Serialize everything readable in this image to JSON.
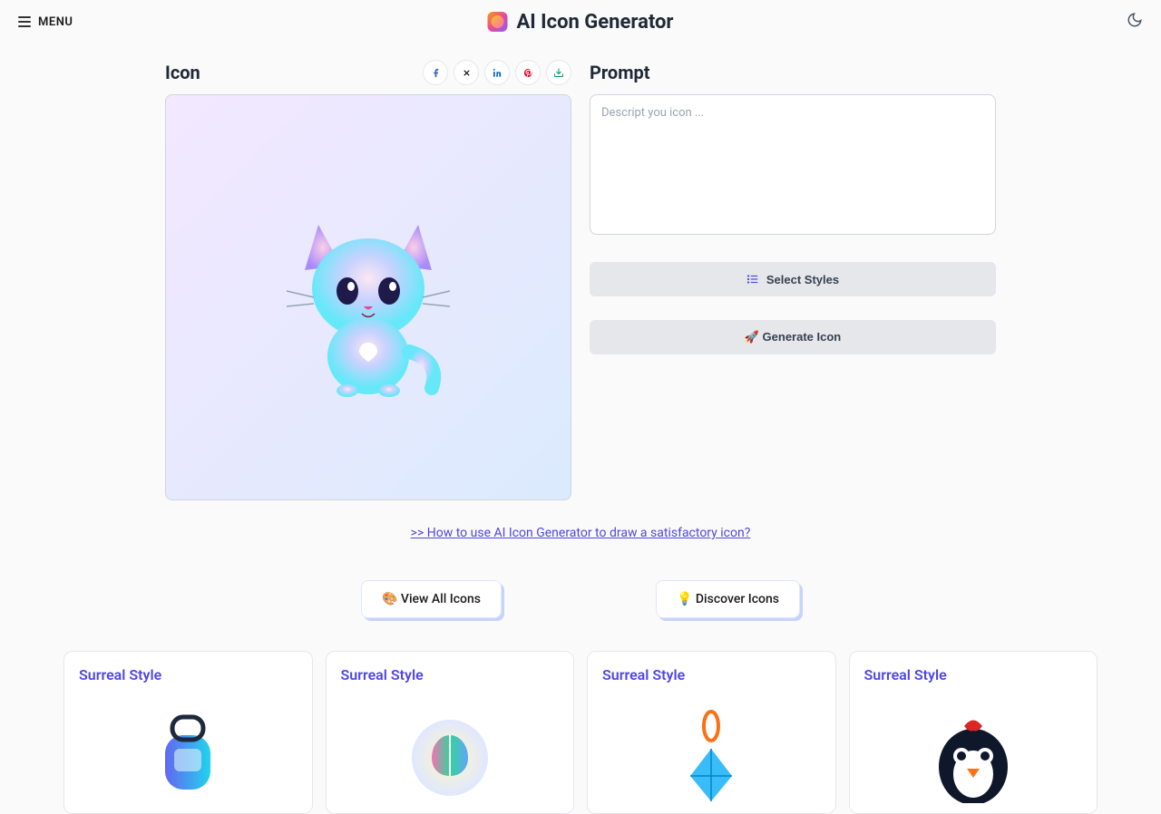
{
  "header": {
    "menu_label": "MENU",
    "title": "AI Icon Generator"
  },
  "icon_section": {
    "label": "Icon"
  },
  "prompt_section": {
    "label": "Prompt",
    "placeholder": "Descript you icon ...",
    "select_styles_label": "Select Styles",
    "generate_label": "🚀 Generate Icon"
  },
  "howto_link": ">> How to use AI Icon Generator to draw a satisfactory icon?",
  "chips": {
    "view_all": "🎨 View All Icons",
    "discover": "💡 Discover Icons"
  },
  "cards": [
    {
      "title": "Surreal Style"
    },
    {
      "title": "Surreal Style"
    },
    {
      "title": "Surreal Style"
    },
    {
      "title": "Surreal Style"
    }
  ]
}
